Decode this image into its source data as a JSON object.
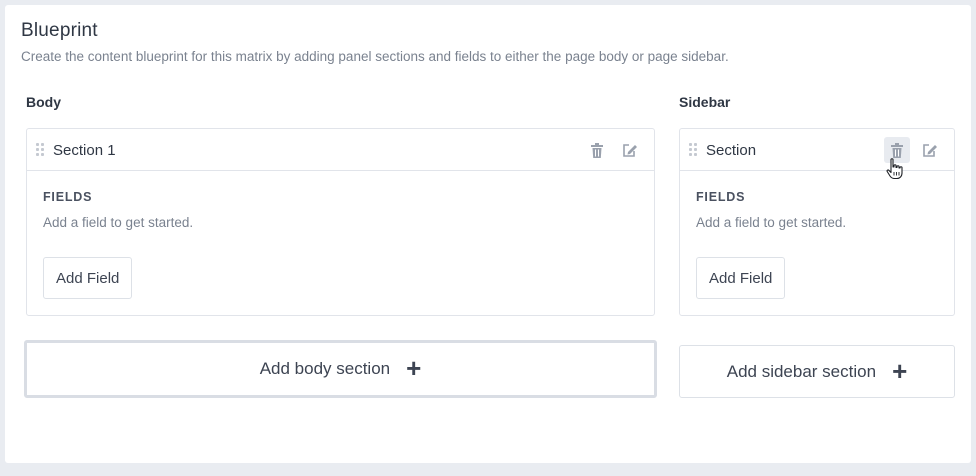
{
  "header": {
    "title": "Blueprint",
    "subtitle": "Create the content blueprint for this matrix by adding panel sections and fields to either the page body or page sidebar."
  },
  "body": {
    "heading": "Body",
    "section": {
      "name": "Section 1",
      "fields_label": "FIELDS",
      "fields_help": "Add a field to get started.",
      "add_field_label": "Add Field"
    },
    "add_section_label": "Add body section"
  },
  "sidebar": {
    "heading": "Sidebar",
    "section": {
      "name": "Section",
      "fields_label": "FIELDS",
      "fields_help": "Add a field to get started.",
      "add_field_label": "Add Field"
    },
    "add_section_label": "Add sidebar section"
  },
  "icons": {
    "drag": "drag-handle-icon",
    "delete": "trash-icon",
    "edit": "edit-icon",
    "add": "plus-icon"
  },
  "colors": {
    "icon": "#9aa1ad",
    "text": "#3d4452",
    "muted": "#7a828f"
  }
}
